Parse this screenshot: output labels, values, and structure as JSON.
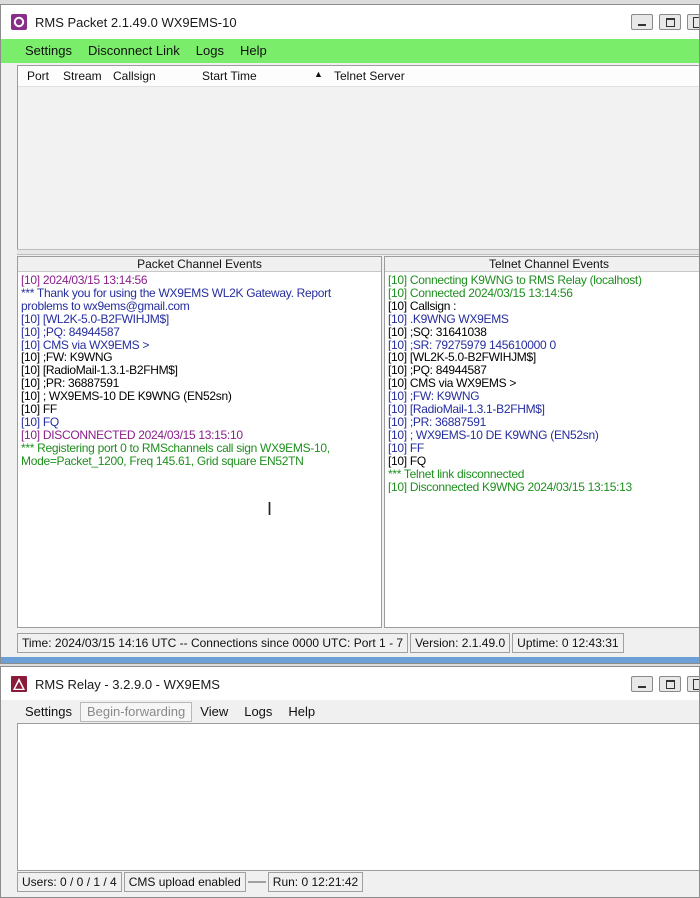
{
  "packet_window": {
    "title": "RMS Packet  2.1.49.0  WX9EMS-10",
    "menu": [
      "Settings",
      "Disconnect Link",
      "Logs",
      "Help"
    ],
    "columns": [
      "Port",
      "Stream",
      "Callsign",
      "Start Time",
      "Telnet Server"
    ],
    "packet_events": {
      "header": "Packet Channel Events",
      "lines": [
        {
          "text": "[10]  2024/03/15 13:14:56",
          "color": "purple"
        },
        {
          "text": "*** Thank you for using the WX9EMS WL2K Gateway. Report",
          "color": "blue"
        },
        {
          "text": "problems to wx9ems@gmail.com",
          "color": "blue"
        },
        {
          "text": "[10] [WL2K-5.0-B2FWIHJM$]",
          "color": "blue"
        },
        {
          "text": "[10] ;PQ: 84944587",
          "color": "blue"
        },
        {
          "text": "[10] CMS via WX9EMS >",
          "color": "blue"
        },
        {
          "text": "[10] ;FW: K9WNG",
          "color": "black"
        },
        {
          "text": "[10] [RadioMail-1.3.1-B2FHM$]",
          "color": "black"
        },
        {
          "text": "[10] ;PR: 36887591",
          "color": "black"
        },
        {
          "text": "[10] ; WX9EMS-10 DE K9WNG (EN52sn)",
          "color": "black"
        },
        {
          "text": "[10] FF",
          "color": "black"
        },
        {
          "text": "[10] FQ",
          "color": "blue"
        },
        {
          "text": "[10] DISCONNECTED 2024/03/15 13:15:10",
          "color": "purple"
        },
        {
          "text": "*** Registering port 0 to RMSchannels call sign WX9EMS-10,",
          "color": "green"
        },
        {
          "text": "Mode=Packet_1200, Freq 145.61, Grid square EN52TN",
          "color": "green"
        }
      ]
    },
    "telnet_events": {
      "header": "Telnet Channel Events",
      "lines": [
        {
          "text": "[10] Connecting K9WNG to RMS Relay (localhost)",
          "color": "green"
        },
        {
          "text": "[10] Connected 2024/03/15 13:14:56",
          "color": "green"
        },
        {
          "text": "[10] Callsign :",
          "color": "black"
        },
        {
          "text": "[10] .K9WNG WX9EMS",
          "color": "blue"
        },
        {
          "text": "[10] ;SQ: 31641038",
          "color": "black"
        },
        {
          "text": "[10] ;SR: 79275979 145610000 0",
          "color": "blue"
        },
        {
          "text": "[10] [WL2K-5.0-B2FWIHJM$]",
          "color": "black"
        },
        {
          "text": "[10] ;PQ: 84944587",
          "color": "black"
        },
        {
          "text": "[10] CMS via WX9EMS >",
          "color": "black"
        },
        {
          "text": "[10] ;FW: K9WNG",
          "color": "blue"
        },
        {
          "text": "[10] [RadioMail-1.3.1-B2FHM$]",
          "color": "blue"
        },
        {
          "text": "[10] ;PR: 36887591",
          "color": "blue"
        },
        {
          "text": "[10] ; WX9EMS-10 DE K9WNG (EN52sn)",
          "color": "blue"
        },
        {
          "text": "[10] FF",
          "color": "blue"
        },
        {
          "text": "[10] FQ",
          "color": "black"
        },
        {
          "text": "*** Telnet link disconnected",
          "color": "green"
        },
        {
          "text": "[10] Disconnected K9WNG 2024/03/15 13:15:13",
          "color": "green"
        }
      ]
    },
    "status": {
      "time": "Time: 2024/03/15 14:16 UTC -- Connections since 0000 UTC:  Port 1 - 7",
      "version": "Version: 2.1.49.0",
      "uptime": "Uptime: 0 12:43:31"
    }
  },
  "relay_window": {
    "title": "RMS Relay - 3.2.9.0 - WX9EMS",
    "menu": {
      "settings": "Settings",
      "begin_forwarding": "Begin-forwarding",
      "view": "View",
      "logs": "Logs",
      "help": "Help"
    },
    "status": {
      "users": "Users: 0 / 0 / 1 / 4",
      "cms": "CMS upload enabled",
      "run": "Run: 0 12:21:42"
    }
  },
  "colors": {
    "menu_green": "#7aed6a",
    "log_purple": "#8b1f8b",
    "log_blue": "#262d9e",
    "log_green": "#1e8f1e"
  }
}
